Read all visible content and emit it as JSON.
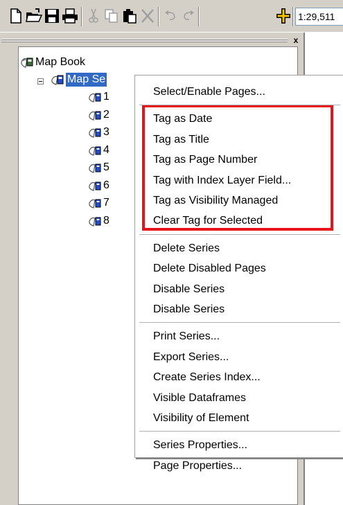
{
  "toolbar": {
    "buttons": [
      {
        "icon": "new-document-icon"
      },
      {
        "icon": "open-folder-icon"
      },
      {
        "icon": "save-icon"
      },
      {
        "icon": "print-icon"
      },
      {
        "icon": "cut-icon"
      },
      {
        "icon": "copy-icon"
      },
      {
        "icon": "paste-icon"
      },
      {
        "icon": "delete-icon"
      },
      {
        "icon": "undo-icon"
      },
      {
        "icon": "redo-icon"
      },
      {
        "icon": "add-data-icon"
      }
    ],
    "scale": "1:29,511"
  },
  "panel": {
    "close_label": "x"
  },
  "tree": {
    "root": {
      "label": "Map Book",
      "icon": "map-book-icon"
    },
    "series": {
      "label": "Map Series",
      "visible_label": "Map Se",
      "icon": "map-series-icon"
    },
    "pages": [
      {
        "label": "1"
      },
      {
        "label": "2"
      },
      {
        "label": "3"
      },
      {
        "label": "4"
      },
      {
        "label": "5"
      },
      {
        "label": "6"
      },
      {
        "label": "7"
      },
      {
        "label": "8"
      }
    ]
  },
  "context_menu": {
    "groups": [
      [
        "Select/Enable Pages..."
      ],
      [
        "Tag as Date",
        "Tag as Title",
        "Tag as Page Number",
        "Tag with Index Layer Field...",
        "Tag as Visibility Managed",
        "Clear Tag for Selected"
      ],
      [
        "Delete Series",
        "Delete Disabled Pages",
        "Disable Series",
        "Disable Series"
      ],
      [
        "Print Series...",
        "Export Series...",
        "Create Series Index...",
        "Visible Dataframes",
        "Visibility of Element"
      ],
      [
        "Series Properties...",
        "Page Properties..."
      ]
    ],
    "highlight_color": "#e8141c",
    "selection_color": "#316ac5"
  }
}
